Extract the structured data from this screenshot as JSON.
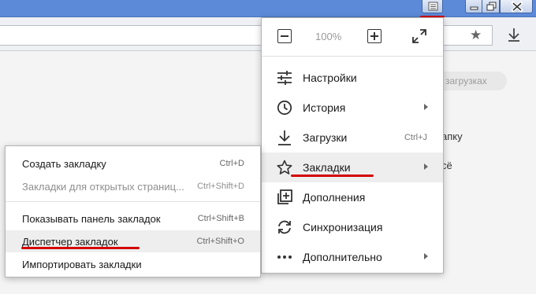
{
  "titlebar": {
    "icons": [
      "menu-icon",
      "minimize-icon",
      "maximize-icon",
      "close-icon"
    ]
  },
  "background_page": {
    "pill_text": "загрузках",
    "text_1": "апку",
    "text_2": "сё"
  },
  "main_menu": {
    "zoom_level": "100%",
    "items": [
      {
        "label": "Настройки",
        "icon": "settings-sliders-icon",
        "shortcut": "",
        "submenu": false
      },
      {
        "label": "История",
        "icon": "history-clock-icon",
        "shortcut": "",
        "submenu": true
      },
      {
        "label": "Загрузки",
        "icon": "download-icon",
        "shortcut": "Ctrl+J",
        "submenu": false
      },
      {
        "label": "Закладки",
        "icon": "star-icon",
        "shortcut": "",
        "submenu": true
      },
      {
        "label": "Дополнения",
        "icon": "extensions-icon",
        "shortcut": "",
        "submenu": false
      },
      {
        "label": "Синхронизация",
        "icon": "sync-icon",
        "shortcut": "",
        "submenu": false
      },
      {
        "label": "Дополнительно",
        "icon": "more-dots-icon",
        "shortcut": "",
        "submenu": true
      }
    ]
  },
  "bookmarks_menu": {
    "items": [
      {
        "label": "Создать закладку",
        "shortcut": "Ctrl+D",
        "disabled": false
      },
      {
        "label": "Закладки для открытых страниц...",
        "shortcut": "Ctrl+Shift+D",
        "disabled": true
      },
      {
        "label": "Показывать панель закладок",
        "shortcut": "Ctrl+Shift+B",
        "disabled": false
      },
      {
        "label": "Диспетчер закладок",
        "shortcut": "Ctrl+Shift+O",
        "disabled": false
      },
      {
        "label": "Импортировать закладки",
        "shortcut": "",
        "disabled": false
      }
    ]
  },
  "colors": {
    "titlebar": "#5c8ad8",
    "highlight_underline": "#d40000",
    "hover_row": "#eeeeee"
  }
}
